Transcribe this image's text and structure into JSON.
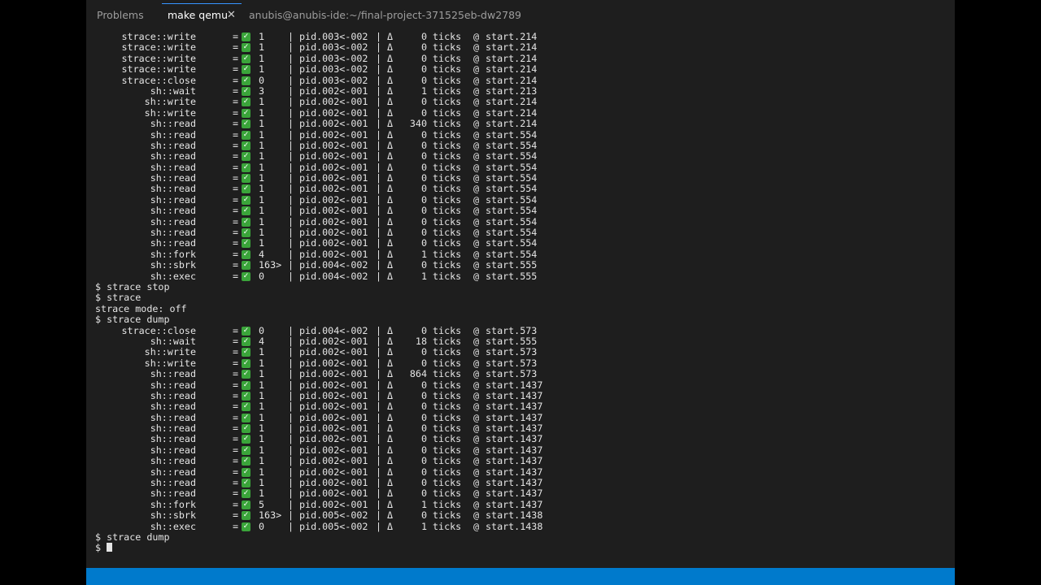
{
  "tabs": [
    {
      "label": "Problems"
    },
    {
      "label": "make qemu"
    },
    {
      "label": "anubis@anubis-ide:~/final-project-371525eb-dw2789"
    }
  ],
  "close_glyph": "✕",
  "check_glyph": "✓",
  "terminal": [
    {
      "name": "strace::write",
      "eq": "=",
      "ret": "1",
      "sep": "|",
      "pid": "pid.003<-002",
      "delta": "Δ",
      "ticks": "0",
      "tword": "ticks",
      "at": "@",
      "start": "start.214"
    },
    {
      "name": "strace::write",
      "eq": "=",
      "ret": "1",
      "sep": "|",
      "pid": "pid.003<-002",
      "delta": "Δ",
      "ticks": "0",
      "tword": "ticks",
      "at": "@",
      "start": "start.214"
    },
    {
      "name": "strace::write",
      "eq": "=",
      "ret": "1",
      "sep": "|",
      "pid": "pid.003<-002",
      "delta": "Δ",
      "ticks": "0",
      "tword": "ticks",
      "at": "@",
      "start": "start.214"
    },
    {
      "name": "strace::write",
      "eq": "=",
      "ret": "1",
      "sep": "|",
      "pid": "pid.003<-002",
      "delta": "Δ",
      "ticks": "0",
      "tword": "ticks",
      "at": "@",
      "start": "start.214"
    },
    {
      "name": "strace::close",
      "eq": "=",
      "ret": "0",
      "sep": "|",
      "pid": "pid.003<-002",
      "delta": "Δ",
      "ticks": "0",
      "tword": "ticks",
      "at": "@",
      "start": "start.214"
    },
    {
      "name": "sh::wait",
      "eq": "=",
      "ret": "3",
      "sep": "|",
      "pid": "pid.002<-001",
      "delta": "Δ",
      "ticks": "1",
      "tword": "ticks",
      "at": "@",
      "start": "start.213"
    },
    {
      "name": "sh::write",
      "eq": "=",
      "ret": "1",
      "sep": "|",
      "pid": "pid.002<-001",
      "delta": "Δ",
      "ticks": "0",
      "tword": "ticks",
      "at": "@",
      "start": "start.214"
    },
    {
      "name": "sh::write",
      "eq": "=",
      "ret": "1",
      "sep": "|",
      "pid": "pid.002<-001",
      "delta": "Δ",
      "ticks": "0",
      "tword": "ticks",
      "at": "@",
      "start": "start.214"
    },
    {
      "name": "sh::read",
      "eq": "=",
      "ret": "1",
      "sep": "|",
      "pid": "pid.002<-001",
      "delta": "Δ",
      "ticks": "340",
      "tword": "ticks",
      "at": "@",
      "start": "start.214"
    },
    {
      "name": "sh::read",
      "eq": "=",
      "ret": "1",
      "sep": "|",
      "pid": "pid.002<-001",
      "delta": "Δ",
      "ticks": "0",
      "tword": "ticks",
      "at": "@",
      "start": "start.554"
    },
    {
      "name": "sh::read",
      "eq": "=",
      "ret": "1",
      "sep": "|",
      "pid": "pid.002<-001",
      "delta": "Δ",
      "ticks": "0",
      "tword": "ticks",
      "at": "@",
      "start": "start.554"
    },
    {
      "name": "sh::read",
      "eq": "=",
      "ret": "1",
      "sep": "|",
      "pid": "pid.002<-001",
      "delta": "Δ",
      "ticks": "0",
      "tword": "ticks",
      "at": "@",
      "start": "start.554"
    },
    {
      "name": "sh::read",
      "eq": "=",
      "ret": "1",
      "sep": "|",
      "pid": "pid.002<-001",
      "delta": "Δ",
      "ticks": "0",
      "tword": "ticks",
      "at": "@",
      "start": "start.554"
    },
    {
      "name": "sh::read",
      "eq": "=",
      "ret": "1",
      "sep": "|",
      "pid": "pid.002<-001",
      "delta": "Δ",
      "ticks": "0",
      "tword": "ticks",
      "at": "@",
      "start": "start.554"
    },
    {
      "name": "sh::read",
      "eq": "=",
      "ret": "1",
      "sep": "|",
      "pid": "pid.002<-001",
      "delta": "Δ",
      "ticks": "0",
      "tword": "ticks",
      "at": "@",
      "start": "start.554"
    },
    {
      "name": "sh::read",
      "eq": "=",
      "ret": "1",
      "sep": "|",
      "pid": "pid.002<-001",
      "delta": "Δ",
      "ticks": "0",
      "tword": "ticks",
      "at": "@",
      "start": "start.554"
    },
    {
      "name": "sh::read",
      "eq": "=",
      "ret": "1",
      "sep": "|",
      "pid": "pid.002<-001",
      "delta": "Δ",
      "ticks": "0",
      "tword": "ticks",
      "at": "@",
      "start": "start.554"
    },
    {
      "name": "sh::read",
      "eq": "=",
      "ret": "1",
      "sep": "|",
      "pid": "pid.002<-001",
      "delta": "Δ",
      "ticks": "0",
      "tword": "ticks",
      "at": "@",
      "start": "start.554"
    },
    {
      "name": "sh::read",
      "eq": "=",
      "ret": "1",
      "sep": "|",
      "pid": "pid.002<-001",
      "delta": "Δ",
      "ticks": "0",
      "tword": "ticks",
      "at": "@",
      "start": "start.554"
    },
    {
      "name": "sh::read",
      "eq": "=",
      "ret": "1",
      "sep": "|",
      "pid": "pid.002<-001",
      "delta": "Δ",
      "ticks": "0",
      "tword": "ticks",
      "at": "@",
      "start": "start.554"
    },
    {
      "name": "sh::fork",
      "eq": "=",
      "ret": "4",
      "sep": "|",
      "pid": "pid.002<-001",
      "delta": "Δ",
      "ticks": "1",
      "tword": "ticks",
      "at": "@",
      "start": "start.554"
    },
    {
      "name": "sh::sbrk",
      "eq": "=",
      "ret": "163>",
      "sep": "|",
      "pid": "pid.004<-002",
      "delta": "Δ",
      "ticks": "0",
      "tword": "ticks",
      "at": "@",
      "start": "start.555"
    },
    {
      "name": "sh::exec",
      "eq": "=",
      "ret": "0",
      "sep": "|",
      "pid": "pid.004<-002",
      "delta": "Δ",
      "ticks": "1",
      "tword": "ticks",
      "at": "@",
      "start": "start.555"
    },
    {
      "text": "$ strace stop"
    },
    {
      "text": "$ strace"
    },
    {
      "text": "strace mode: off"
    },
    {
      "text": "$ strace dump"
    },
    {
      "name": "strace::close",
      "eq": "=",
      "ret": "0",
      "sep": "|",
      "pid": "pid.004<-002",
      "delta": "Δ",
      "ticks": "0",
      "tword": "ticks",
      "at": "@",
      "start": "start.573"
    },
    {
      "name": "sh::wait",
      "eq": "=",
      "ret": "4",
      "sep": "|",
      "pid": "pid.002<-001",
      "delta": "Δ",
      "ticks": "18",
      "tword": "ticks",
      "at": "@",
      "start": "start.555"
    },
    {
      "name": "sh::write",
      "eq": "=",
      "ret": "1",
      "sep": "|",
      "pid": "pid.002<-001",
      "delta": "Δ",
      "ticks": "0",
      "tword": "ticks",
      "at": "@",
      "start": "start.573"
    },
    {
      "name": "sh::write",
      "eq": "=",
      "ret": "1",
      "sep": "|",
      "pid": "pid.002<-001",
      "delta": "Δ",
      "ticks": "0",
      "tword": "ticks",
      "at": "@",
      "start": "start.573"
    },
    {
      "name": "sh::read",
      "eq": "=",
      "ret": "1",
      "sep": "|",
      "pid": "pid.002<-001",
      "delta": "Δ",
      "ticks": "864",
      "tword": "ticks",
      "at": "@",
      "start": "start.573"
    },
    {
      "name": "sh::read",
      "eq": "=",
      "ret": "1",
      "sep": "|",
      "pid": "pid.002<-001",
      "delta": "Δ",
      "ticks": "0",
      "tword": "ticks",
      "at": "@",
      "start": "start.1437"
    },
    {
      "name": "sh::read",
      "eq": "=",
      "ret": "1",
      "sep": "|",
      "pid": "pid.002<-001",
      "delta": "Δ",
      "ticks": "0",
      "tword": "ticks",
      "at": "@",
      "start": "start.1437"
    },
    {
      "name": "sh::read",
      "eq": "=",
      "ret": "1",
      "sep": "|",
      "pid": "pid.002<-001",
      "delta": "Δ",
      "ticks": "0",
      "tword": "ticks",
      "at": "@",
      "start": "start.1437"
    },
    {
      "name": "sh::read",
      "eq": "=",
      "ret": "1",
      "sep": "|",
      "pid": "pid.002<-001",
      "delta": "Δ",
      "ticks": "0",
      "tword": "ticks",
      "at": "@",
      "start": "start.1437"
    },
    {
      "name": "sh::read",
      "eq": "=",
      "ret": "1",
      "sep": "|",
      "pid": "pid.002<-001",
      "delta": "Δ",
      "ticks": "0",
      "tword": "ticks",
      "at": "@",
      "start": "start.1437"
    },
    {
      "name": "sh::read",
      "eq": "=",
      "ret": "1",
      "sep": "|",
      "pid": "pid.002<-001",
      "delta": "Δ",
      "ticks": "0",
      "tword": "ticks",
      "at": "@",
      "start": "start.1437"
    },
    {
      "name": "sh::read",
      "eq": "=",
      "ret": "1",
      "sep": "|",
      "pid": "pid.002<-001",
      "delta": "Δ",
      "ticks": "0",
      "tword": "ticks",
      "at": "@",
      "start": "start.1437"
    },
    {
      "name": "sh::read",
      "eq": "=",
      "ret": "1",
      "sep": "|",
      "pid": "pid.002<-001",
      "delta": "Δ",
      "ticks": "0",
      "tword": "ticks",
      "at": "@",
      "start": "start.1437"
    },
    {
      "name": "sh::read",
      "eq": "=",
      "ret": "1",
      "sep": "|",
      "pid": "pid.002<-001",
      "delta": "Δ",
      "ticks": "0",
      "tword": "ticks",
      "at": "@",
      "start": "start.1437"
    },
    {
      "name": "sh::read",
      "eq": "=",
      "ret": "1",
      "sep": "|",
      "pid": "pid.002<-001",
      "delta": "Δ",
      "ticks": "0",
      "tword": "ticks",
      "at": "@",
      "start": "start.1437"
    },
    {
      "name": "sh::read",
      "eq": "=",
      "ret": "1",
      "sep": "|",
      "pid": "pid.002<-001",
      "delta": "Δ",
      "ticks": "0",
      "tword": "ticks",
      "at": "@",
      "start": "start.1437"
    },
    {
      "name": "sh::fork",
      "eq": "=",
      "ret": "5",
      "sep": "|",
      "pid": "pid.002<-001",
      "delta": "Δ",
      "ticks": "1",
      "tword": "ticks",
      "at": "@",
      "start": "start.1437"
    },
    {
      "name": "sh::sbrk",
      "eq": "=",
      "ret": "163>",
      "sep": "|",
      "pid": "pid.005<-002",
      "delta": "Δ",
      "ticks": "0",
      "tword": "ticks",
      "at": "@",
      "start": "start.1438"
    },
    {
      "name": "sh::exec",
      "eq": "=",
      "ret": "0",
      "sep": "|",
      "pid": "pid.005<-002",
      "delta": "Δ",
      "ticks": "1",
      "tword": "ticks",
      "at": "@",
      "start": "start.1438"
    },
    {
      "text": "$ strace dump"
    }
  ],
  "prompt": "$",
  "colors": {
    "terminal_bg": "#1e1e1e",
    "check_green": "#3aa43a",
    "status_bar": "#007acc",
    "tab_active_indicator": "#3794ff"
  }
}
